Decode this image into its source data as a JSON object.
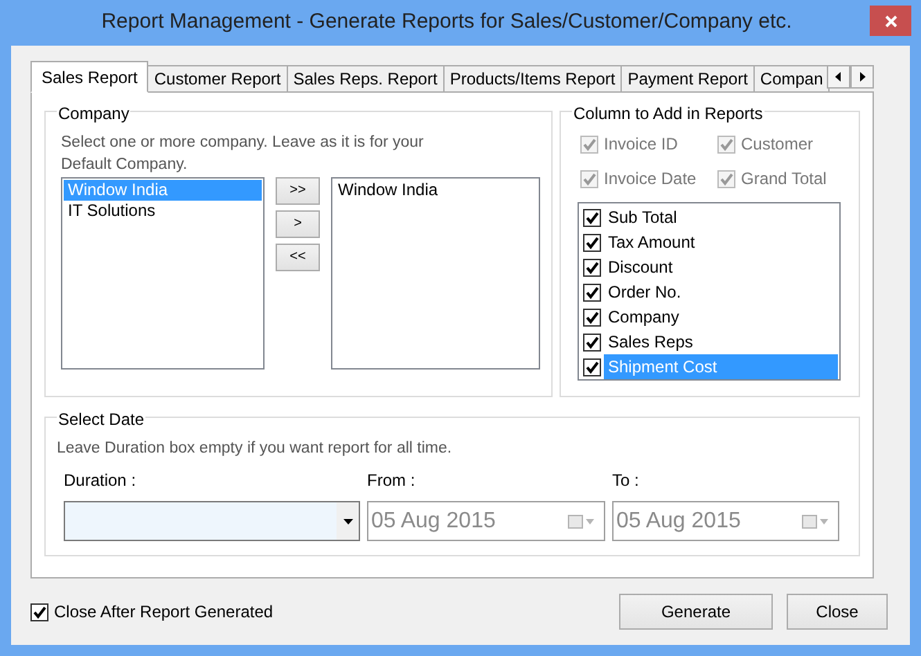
{
  "window": {
    "title": "Report Management - Generate Reports for Sales/Customer/Company etc."
  },
  "tabs": [
    {
      "label": "Sales Report",
      "selected": true
    },
    {
      "label": "Customer Report",
      "selected": false
    },
    {
      "label": "Sales Reps. Report",
      "selected": false
    },
    {
      "label": "Products/Items Report",
      "selected": false
    },
    {
      "label": "Payment Report",
      "selected": false
    },
    {
      "label": "Compan",
      "selected": false
    }
  ],
  "company": {
    "title": "Company",
    "hint": "Select one or more company. Leave as it is for your Default Company.",
    "available": [
      {
        "label": "Window India",
        "selected": true
      },
      {
        "label": "IT Solutions",
        "selected": false
      }
    ],
    "buttons": [
      ">>",
      ">",
      "<<"
    ],
    "chosen": [
      {
        "label": "Window India",
        "selected": false
      }
    ]
  },
  "columns": {
    "title": "Column to Add in Reports",
    "fixed": [
      {
        "label": "Invoice ID",
        "checked": true,
        "disabled": true
      },
      {
        "label": "Customer",
        "checked": true,
        "disabled": true
      },
      {
        "label": "Invoice Date",
        "checked": true,
        "disabled": true
      },
      {
        "label": "Grand Total",
        "checked": true,
        "disabled": true
      }
    ],
    "list": [
      {
        "label": "Sub Total",
        "checked": true,
        "selected": false
      },
      {
        "label": "Tax Amount",
        "checked": true,
        "selected": false
      },
      {
        "label": "Discount",
        "checked": true,
        "selected": false
      },
      {
        "label": "Order No.",
        "checked": true,
        "selected": false
      },
      {
        "label": "Company",
        "checked": true,
        "selected": false
      },
      {
        "label": "Sales Reps",
        "checked": true,
        "selected": false
      },
      {
        "label": "Shipment Cost",
        "checked": true,
        "selected": true
      }
    ]
  },
  "date": {
    "title": "Select Date",
    "hint": "Leave Duration box empty if you want report for all time.",
    "duration": {
      "label": "Duration :"
    },
    "from": {
      "label": "From :",
      "value": "05 Aug 2015",
      "disabled": true
    },
    "to": {
      "label": "To :",
      "value": "05 Aug 2015",
      "disabled": true
    }
  },
  "footer": {
    "close_after": {
      "label": "Close After Report Generated",
      "checked": true
    },
    "buttons": [
      "Generate",
      "Close"
    ]
  }
}
